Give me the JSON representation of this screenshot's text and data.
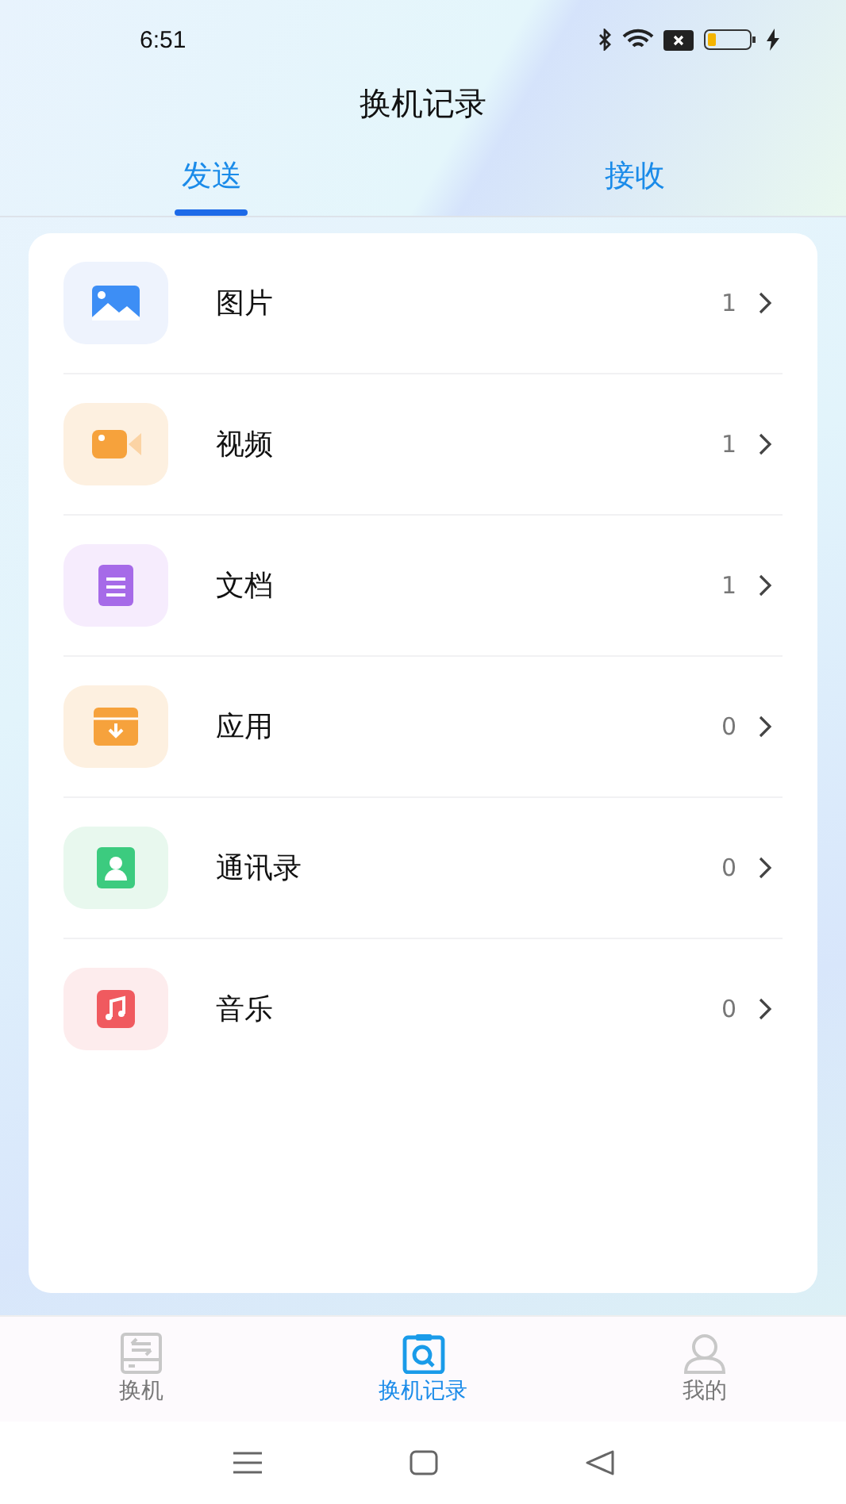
{
  "status_bar": {
    "time": "6:51"
  },
  "header": {
    "title": "换机记录"
  },
  "tabs": [
    {
      "label": "发送",
      "selected": true
    },
    {
      "label": "接收",
      "selected": false
    }
  ],
  "categories": [
    {
      "name": "图片",
      "count": "1"
    },
    {
      "name": "视频",
      "count": "1"
    },
    {
      "name": "文档",
      "count": "1"
    },
    {
      "name": "应用",
      "count": "0"
    },
    {
      "name": "通讯录",
      "count": "0"
    },
    {
      "name": "音乐",
      "count": "0"
    }
  ],
  "bottom_nav": [
    {
      "label": "换机",
      "selected": false
    },
    {
      "label": "换机记录",
      "selected": true
    },
    {
      "label": "我的",
      "selected": false
    }
  ]
}
